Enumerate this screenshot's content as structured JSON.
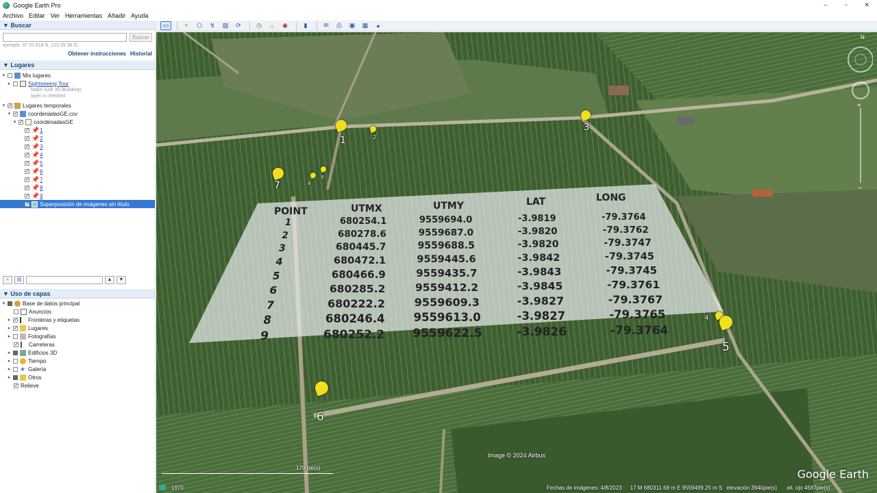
{
  "window": {
    "title": "Google Earth Pro",
    "minimize": "–",
    "maximize": "▫",
    "close": "✕"
  },
  "menu": [
    "Archivo",
    "Editar",
    "Ver",
    "Herramientas",
    "Añadir",
    "Ayuda"
  ],
  "search": {
    "header": "Buscar",
    "button": "Buscar",
    "hint": "ejemplo: 37 25.818 N, 122 05.36 O",
    "directions": "Obtener instrucciones",
    "history": "Historial"
  },
  "places": {
    "header": "Lugares",
    "items": [
      {
        "label": "Mis lugares"
      },
      {
        "label": "Sightseeing Tour"
      },
      {
        "label": "Make sure 3D Buildings"
      },
      {
        "label": "layer is checked"
      },
      {
        "label": "Lugares temporales"
      },
      {
        "label": "coordenadasGE.csv"
      },
      {
        "label": "coordenadasGE"
      },
      {
        "label": "1"
      },
      {
        "label": "2"
      },
      {
        "label": "3"
      },
      {
        "label": "4"
      },
      {
        "label": "5"
      },
      {
        "label": "6"
      },
      {
        "label": "7"
      },
      {
        "label": "8"
      },
      {
        "label": "9"
      },
      {
        "label": "Superposición de imágenes sin título"
      }
    ]
  },
  "layers": {
    "header": "Uso de capas",
    "items": [
      {
        "label": "Base de datos principal"
      },
      {
        "label": "Anuncios"
      },
      {
        "label": "Fronteras y etiquetas"
      },
      {
        "label": "Lugares"
      },
      {
        "label": "Fotografías"
      },
      {
        "label": "Carreteras"
      },
      {
        "label": "Edificios 3D"
      },
      {
        "label": "Tiempo"
      },
      {
        "label": "Galería"
      },
      {
        "label": "Otros"
      },
      {
        "label": "Relieve"
      }
    ]
  },
  "overlay": {
    "headers": [
      "POINT",
      "UTMX",
      "UTMY",
      "LAT",
      "LONG"
    ],
    "rows": [
      [
        "1",
        "680254.1",
        "9559694.0",
        "-3.9819",
        "-79.3764"
      ],
      [
        "2",
        "680278.6",
        "9559687.0",
        "-3.9820",
        "-79.3762"
      ],
      [
        "3",
        "680445.7",
        "9559688.5",
        "-3.9820",
        "-79.3747"
      ],
      [
        "4",
        "680472.1",
        "9559445.6",
        "-3.9842",
        "-79.3745"
      ],
      [
        "5",
        "680466.9",
        "9559435.7",
        "-3.9843",
        "-79.3745"
      ],
      [
        "6",
        "680285.2",
        "9559412.2",
        "-3.9845",
        "-79.3761"
      ],
      [
        "7",
        "680222.2",
        "9559609.3",
        "-3.9827",
        "-79.3767"
      ],
      [
        "8",
        "680246.4",
        "9559613.0",
        "-3.9827",
        "-79.3765"
      ],
      [
        "9",
        "680252.2",
        "9559622.5",
        "-3.9826",
        "-79.3764"
      ]
    ]
  },
  "map_pins": [
    "1",
    "2",
    "3",
    "4",
    "5",
    "6",
    "7",
    "8",
    "9"
  ],
  "map": {
    "credit": "Image © 2024 Airbus",
    "brand": "Google Earth",
    "scale": "179 pie(s)",
    "year": "1970",
    "status_date": "Fechas de imágenes: 4/8/2023",
    "status_coords": "17 M 680311.68 m E 9559499.25 m S",
    "status_elev": "elevación  3940pie(s)",
    "status_alt": "alt. ojo  4587pie(s)"
  }
}
